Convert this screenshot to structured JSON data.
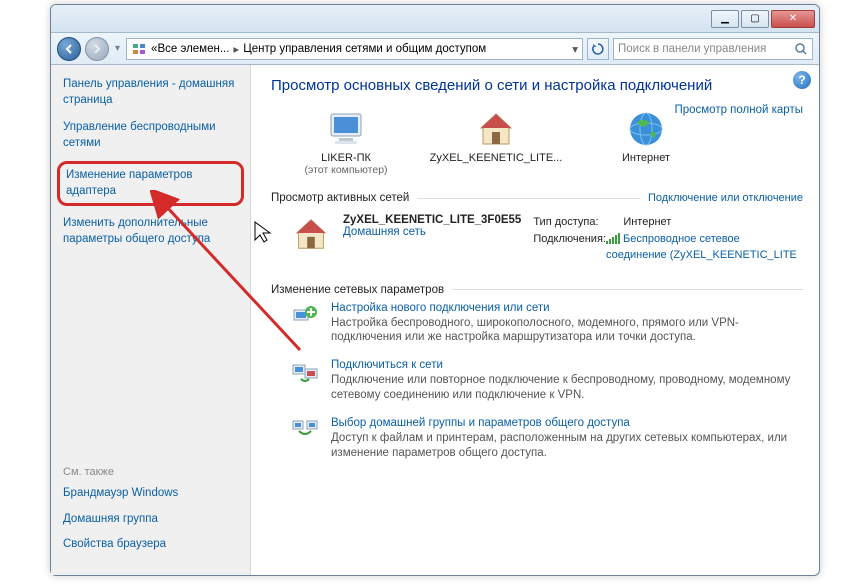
{
  "titlebar": {
    "min": "▁",
    "max": "▢",
    "close": "✕"
  },
  "address": {
    "crumb1": "Все элемен...",
    "crumb2": "Центр управления сетями и общим доступом",
    "searchPlaceholder": "Поиск в панели управления"
  },
  "sidebar": {
    "home": "Панель управления - домашняя страница",
    "links": [
      "Управление беспроводными сетями",
      "Изменение параметров адаптера",
      "Изменить дополнительные параметры общего доступа"
    ],
    "seealsoLabel": "См. также",
    "seealso": [
      "Брандмауэр Windows",
      "Домашняя группа",
      "Свойства браузера"
    ]
  },
  "main": {
    "title": "Просмотр основных сведений о сети и настройка подключений",
    "fullMap": "Просмотр полной карты",
    "map": {
      "pc": "LIKER-ПК",
      "pcsub": "(этот компьютер)",
      "router": "ZyXEL_KEENETIC_LITE...",
      "internet": "Интернет"
    },
    "activeHeader": "Просмотр активных сетей",
    "activeAction": "Подключение или отключение",
    "network": {
      "name": "ZyXEL_KEENETIC_LITE_3F0E55",
      "type": "Домашняя сеть",
      "accessLabel": "Тип доступа:",
      "accessValue": "Интернет",
      "connLabel": "Подключения:",
      "connValue": "Беспроводное сетевое соединение (ZyXEL_KEENETIC_LITE"
    },
    "changeHeader": "Изменение сетевых параметров",
    "changes": [
      {
        "title": "Настройка нового подключения или сети",
        "desc": "Настройка беспроводного, широкополосного, модемного, прямого или VPN-подключения или же настройка маршрутизатора или точки доступа."
      },
      {
        "title": "Подключиться к сети",
        "desc": "Подключение или повторное подключение к беспроводному, проводному, модемному сетевому соединению или подключение к VPN."
      },
      {
        "title": "Выбор домашней группы и параметров общего доступа",
        "desc": "Доступ к файлам и принтерам, расположенным на других сетевых компьютерах, или изменение параметров общего доступа."
      }
    ]
  }
}
